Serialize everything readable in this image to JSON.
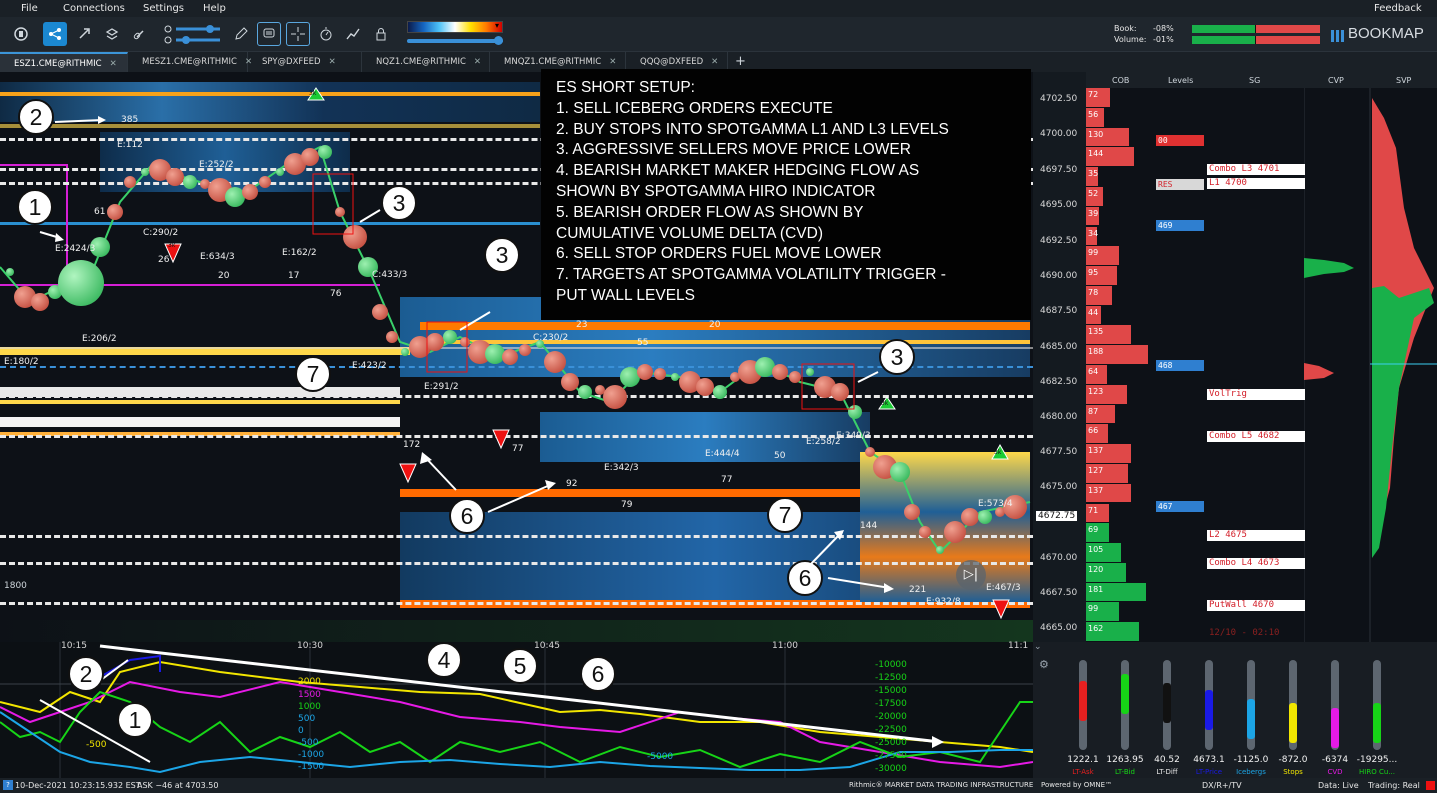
{
  "menu": {
    "file": "File",
    "connections": "Connections",
    "settings": "Settings",
    "help": "Help",
    "feedback": "Feedback"
  },
  "stats": {
    "book_label": "Book:",
    "book_value": "-08%",
    "volume_label": "Volume:",
    "volume_value": "-01%"
  },
  "brand": "BOOKMAP",
  "tabs": [
    {
      "label": "ESZ1.CME@RITHMIC"
    },
    {
      "label": "MESZ1.CME@RITHMIC"
    },
    {
      "label": "SPY@DXFEED"
    },
    {
      "label": "NQZ1.CME@RITHMIC"
    },
    {
      "label": "MNQZ1.CME@RITHMIC"
    },
    {
      "label": "QQQ@DXFEED"
    }
  ],
  "tab_add": "+",
  "note": {
    "lines": [
      "ES SHORT SETUP:",
      "1. SELL ICEBERG ORDERS EXECUTE",
      "2. BUY STOPS INTO SPOTGAMMA L1 AND L3 LEVELS",
      "3. AGGRESSIVE SELLERS MOVE PRICE LOWER",
      "4. BEARISH MARKET MAKER HEDGING FLOW AS",
      "SHOWN BY SPOTGAMMA HIRO INDICATOR",
      "5. BEARISH ORDER FLOW AS SHOWN BY",
      "CUMULATIVE VOLUME DELTA (CVD)",
      "6. SELL STOP ORDERS FUEL MOVE LOWER",
      "7. TARGETS AT SPOTGAMMA VOLATILITY TRIGGER -",
      "PUT WALL LEVELS"
    ]
  },
  "markers": [
    "1",
    "2",
    "3",
    "3",
    "3",
    "6",
    "6",
    "6",
    "7",
    "7",
    "4",
    "5",
    "6",
    "2",
    "1"
  ],
  "chart_labels": [
    "E:112",
    "E:2424/3",
    "E:252/2",
    "C:290/2",
    "E:634/3",
    "E:162/2",
    "C:433/3",
    "E:206/2",
    "E:180/2",
    "E:423/2",
    "E:291/2",
    "C:230/2",
    "E:342/3",
    "E:444/4",
    "E:258/2",
    "E:349/3",
    "E:573/4",
    "E:467/3",
    "E:932/8",
    "385",
    "61",
    "26",
    "20",
    "17",
    "76",
    "172",
    "77",
    "92",
    "79",
    "77",
    "50",
    "144",
    "221",
    "23",
    "20",
    "55",
    "3k",
    "3k",
    "3k",
    "3k",
    "1800"
  ],
  "right_headers": {
    "cob": "COB",
    "levels": "Levels",
    "sg": "SG",
    "cvp": "CVP",
    "svp": "SVP"
  },
  "prices": [
    "4702.50",
    "4700.00",
    "4697.50",
    "4695.00",
    "4692.50",
    "4690.00",
    "4687.50",
    "4685.00",
    "4682.50",
    "4680.00",
    "4677.50",
    "4675.00",
    "4672.75",
    "4670.00",
    "4667.50",
    "4665.00"
  ],
  "cob_values": [
    "72",
    "56",
    "130",
    "144",
    "35",
    "52",
    "39",
    "34",
    "99",
    "95",
    "78",
    "44",
    "135",
    "188",
    "64",
    "123",
    "87",
    "66",
    "137",
    "127",
    "137",
    "71",
    "69",
    "105",
    "120",
    "181",
    "99",
    "162"
  ],
  "levels": [
    {
      "label": "00",
      "color": "#e03131"
    },
    {
      "label": "RES",
      "color": "#d8d8d8"
    },
    {
      "label": "469",
      "color": "#2f7fd0"
    },
    {
      "label": "468",
      "color": "#2f7fd0"
    },
    {
      "label": "467",
      "color": "#2f7fd0"
    }
  ],
  "sg_levels": [
    {
      "label": "Combo L3 4701"
    },
    {
      "label": "L1 4700"
    },
    {
      "label": "VolTrig"
    },
    {
      "label": "Combo L5 4682"
    },
    {
      "label": "L2 4675"
    },
    {
      "label": "Combo L4 4673"
    },
    {
      "label": "PutWall 4670"
    },
    {
      "label": "12/10 - 02:10"
    }
  ],
  "time_labels": [
    "10:15",
    "10:30",
    "10:45",
    "11:00",
    "11:1"
  ],
  "left_axis": [
    "2000",
    "1500",
    "1000",
    "500",
    "0",
    "-500",
    "-1000",
    "-1500"
  ],
  "left_axis_small": [
    "-500",
    "2000",
    "1500",
    "1000",
    "500",
    "0",
    "-5000"
  ],
  "right_axis": [
    "-10000",
    "-12500",
    "-15000",
    "-17500",
    "-20000",
    "-22500",
    "-25000",
    "-27500",
    "-30000"
  ],
  "meters": [
    {
      "value": "1222.1",
      "label": "LT-Ask",
      "color": "#e62020",
      "level": 0.55
    },
    {
      "value": "1263.95",
      "label": "LT-Bid",
      "color": "#17d417",
      "level": 0.62
    },
    {
      "value": "40.52",
      "label": "LT-Diff",
      "color": "#111111",
      "level": 0.52
    },
    {
      "value": "4673.1",
      "label": "LT-Price",
      "color": "#1a1ae6",
      "level": 0.45
    },
    {
      "value": "-1125.0",
      "label": "Icebergs",
      "color": "#1ca5e6",
      "level": 0.35
    },
    {
      "value": "-872.0",
      "label": "Stops",
      "color": "#f2e600",
      "level": 0.3
    },
    {
      "value": "-6374",
      "label": "CVD",
      "color": "#e61ae6",
      "level": 0.25
    },
    {
      "value": "-19295...",
      "label": "HIRO Cu...",
      "color": "#17d417",
      "level": 0.3
    }
  ],
  "status": {
    "datetime": "10-Dec-2021 10:23:15.932 EST",
    "ask": "ASK −46 at 4703.50",
    "rithmic": "Rithmic® MARKET DATA TRADING INFRASTRUCTURE",
    "powered": "Powered by OMNE™",
    "dx": "DX/R+/TV",
    "data": "Data: Live",
    "trading": "Trading: Real"
  }
}
